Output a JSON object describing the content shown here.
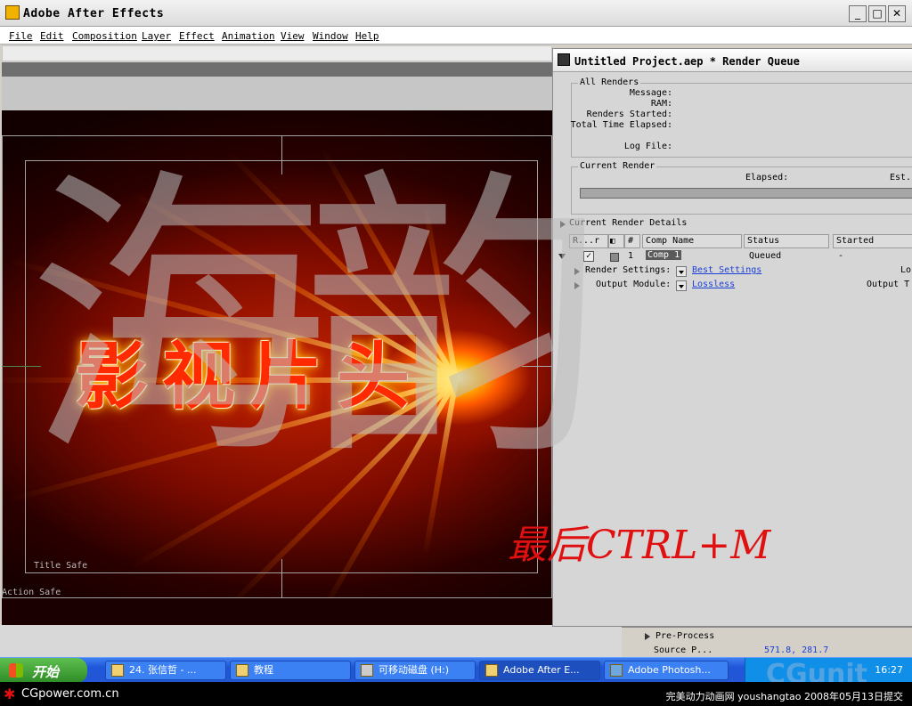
{
  "app": {
    "title": "Adobe After Effects",
    "window_buttons": {
      "minimize": "_",
      "maximize": "□",
      "close": "✕"
    }
  },
  "menu": {
    "items": [
      "File",
      "Edit",
      "Composition",
      "Layer",
      "Effect",
      "Animation",
      "View",
      "Window",
      "Help"
    ]
  },
  "comp": {
    "title_text": "影视片头",
    "title_safe_label": "Title Safe",
    "action_safe_label": "Action Safe"
  },
  "render_queue": {
    "title": "Untitled Project.aep * Render Queue",
    "all_renders": {
      "label": "All Renders",
      "message": "Message:",
      "ram": "RAM:",
      "renders_started": "Renders Started:",
      "total_time_elapsed": "Total Time Elapsed:",
      "log_file": "Log File:"
    },
    "current_render": {
      "label": "Current Render",
      "elapsed": "Elapsed:",
      "est": "Est."
    },
    "details_label": "Current Render Details",
    "columns": [
      "R...r",
      "#",
      "Comp Name",
      "Status",
      "Started"
    ],
    "rows": [
      {
        "num": "1",
        "comp_name": "Comp 1",
        "status": "Queued",
        "started": "-"
      }
    ],
    "render_settings_label": "Render Settings:",
    "render_settings_value": "Best Settings",
    "render_settings_right": "Lo",
    "output_module_label": "Output Module:",
    "output_module_value": "Lossless",
    "output_module_right": "Output T"
  },
  "behind_panel": {
    "pre_process": "Pre-Process",
    "source_label": "Source P...",
    "coords": "571.8, 281.7"
  },
  "watermarks": {
    "big": "海韵",
    "red_hint": "最后CTRL+M",
    "cgunit": "CGunit"
  },
  "taskbar": {
    "start": "开始",
    "tasks": [
      "24. 张信哲 - ...",
      "教程",
      "可移动磁盘 (H:)",
      "Adobe After E...",
      "Adobe Photosh..."
    ],
    "clock": "16:27"
  },
  "footer": {
    "site": "CGpower.com.cn",
    "credit": "完美动力动画网 youshangtao 2008年05月13日提交"
  },
  "colors": {
    "taskbar_blue": "#2457d6",
    "start_green": "#3a9b32",
    "link_blue": "#1b3fd6",
    "title_red": "#ff2a00",
    "hint_red": "#e01010"
  }
}
